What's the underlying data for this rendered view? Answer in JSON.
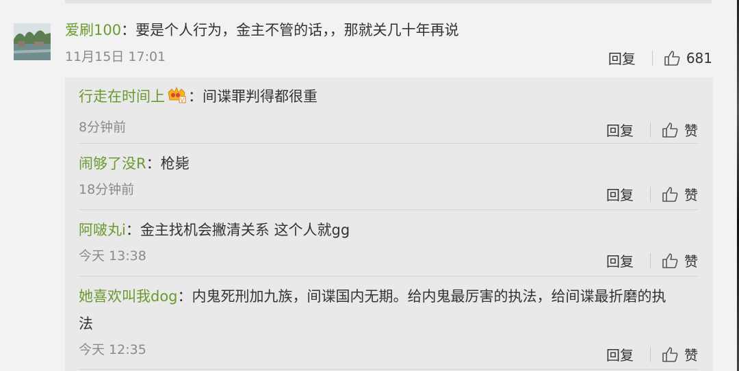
{
  "main_comment": {
    "username": "爱刷100",
    "separator": "：",
    "text": "要是个人行为，金主不管的话，，那就关几十年再说",
    "time": "11月15日 17:01",
    "reply_label": "回复",
    "like_count": "681"
  },
  "replies": [
    {
      "username": "行走在时间上",
      "badge_icon": "crown-badge-icon",
      "separator": "：",
      "text": "间谍罪判得都很重",
      "time": "8分钟前",
      "reply_label": "回复",
      "like_label": "赞"
    },
    {
      "username": "闹够了没R",
      "separator": "：",
      "text": "枪毙",
      "time": "18分钟前",
      "reply_label": "回复",
      "like_label": "赞"
    },
    {
      "username": "阿啵丸i",
      "separator": "：",
      "text": "金主找机会撇清关系 这个人就gg",
      "time": "今天 13:38",
      "reply_label": "回复",
      "like_label": "赞"
    },
    {
      "username": "她喜欢叫我dog",
      "separator": "：",
      "text": "内鬼死刑加九族，间谍国内无期。给内鬼最厉害的执法，给间谍最折磨的执",
      "text_line2": "法",
      "time": "今天 12:35",
      "reply_label": "回复",
      "like_label": "赞"
    }
  ],
  "colors": {
    "username": "#6a9a2f",
    "time": "#8a8a8a",
    "background": "#f2f2f2",
    "reply_box": "#e9e9e9"
  }
}
